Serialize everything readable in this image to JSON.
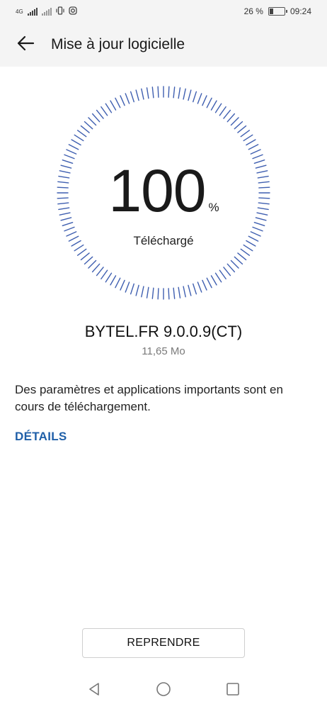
{
  "status_bar": {
    "network": "4G",
    "battery_percent": "26 %",
    "battery_level": 0.26,
    "time": "09:24"
  },
  "app_bar": {
    "back_icon": "arrow-left-icon",
    "title": "Mise à jour logicielle"
  },
  "progress": {
    "value": "100",
    "unit": "%",
    "fraction": 1.0,
    "status": "Téléchargé"
  },
  "package": {
    "version": "BYTEL.FR 9.0.0.9(CT)",
    "size": "11,65  Mo"
  },
  "message": "Des paramètres et applications importants sont en cours de téléchargement.",
  "details_link": "DÉTAILS",
  "resume_button": "REPRENDRE",
  "nav": {
    "back_icon": "triangle-back-icon",
    "home_icon": "circle-home-icon",
    "recents_icon": "square-recents-icon"
  },
  "colors": {
    "accent": "#1f5fa8",
    "ring": "#3f5fb0",
    "bar_background": "#f4f4f4"
  }
}
